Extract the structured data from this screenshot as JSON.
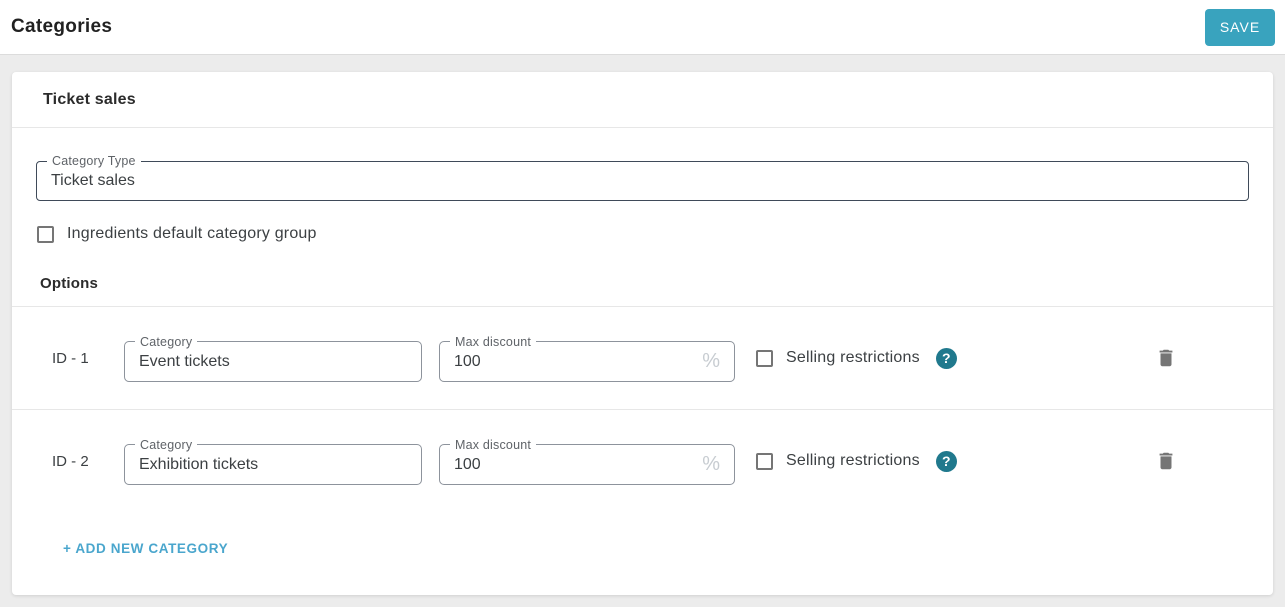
{
  "header": {
    "title": "Categories",
    "save_label": "SAVE"
  },
  "card": {
    "section_title": "Ticket sales",
    "category_type": {
      "label": "Category Type",
      "value": "Ticket sales"
    },
    "ingredients_checkbox_label": "Ingredients default category group",
    "options_label": "Options",
    "rows": [
      {
        "id_label": "ID - 1",
        "category": {
          "label": "Category",
          "value": "Event tickets"
        },
        "max_discount": {
          "label": "Max discount",
          "value": "100",
          "suffix": "%"
        },
        "selling_restrictions_label": "Selling restrictions"
      },
      {
        "id_label": "ID - 2",
        "category": {
          "label": "Category",
          "value": "Exhibition tickets"
        },
        "max_discount": {
          "label": "Max discount",
          "value": "100",
          "suffix": "%"
        },
        "selling_restrictions_label": "Selling restrictions"
      }
    ],
    "add_button_label": "+ ADD NEW CATEGORY"
  },
  "icons": {
    "help_glyph": "?"
  },
  "colors": {
    "accent_teal": "#39a3be",
    "help_icon_teal": "#20798d",
    "add_link_blue": "#4aa6cd",
    "trash_gray": "#757575",
    "background_gray": "#ececec"
  }
}
